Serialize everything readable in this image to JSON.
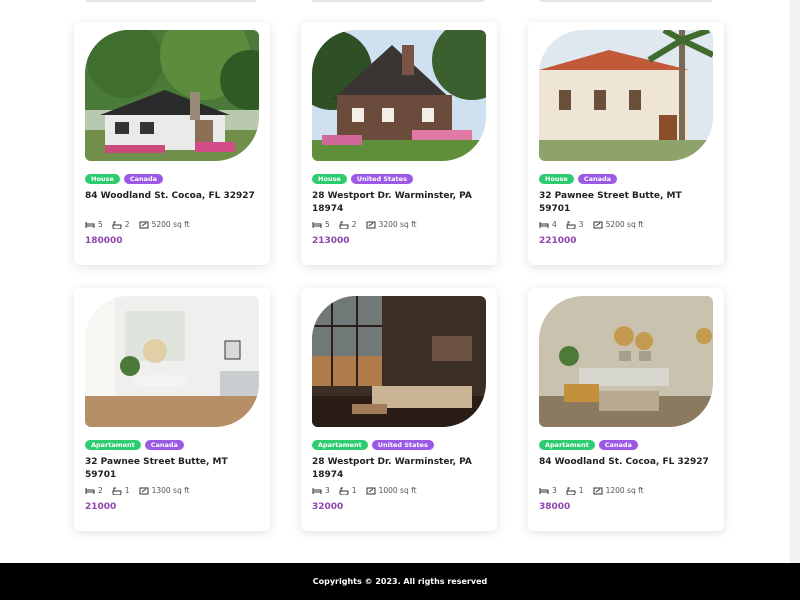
{
  "listings": [
    {
      "type": "House",
      "country": "Canada",
      "address": "84 Woodland St. Cocoa, FL 32927",
      "beds": "5",
      "baths": "2",
      "area": "5200 sq ft",
      "price": "180000"
    },
    {
      "type": "House",
      "country": "United States",
      "address": "28 Westport Dr. Warminster, PA 18974",
      "beds": "5",
      "baths": "2",
      "area": "3200 sq ft",
      "price": "213000"
    },
    {
      "type": "House",
      "country": "Canada",
      "address": "32 Pawnee Street Butte, MT 59701",
      "beds": "4",
      "baths": "3",
      "area": "5200 sq ft",
      "price": "221000"
    },
    {
      "type": "Apartament",
      "country": "Canada",
      "address": "32 Pawnee Street Butte, MT 59701",
      "beds": "2",
      "baths": "1",
      "area": "1300 sq ft",
      "price": "21000"
    },
    {
      "type": "Apartament",
      "country": "United States",
      "address": "28 Westport Dr. Warminster, PA 18974",
      "beds": "3",
      "baths": "1",
      "area": "1000 sq ft",
      "price": "32000"
    },
    {
      "type": "Apartament",
      "country": "Canada",
      "address": "84 Woodland St. Cocoa, FL 32927",
      "beds": "3",
      "baths": "1",
      "area": "1200 sq ft",
      "price": "38000"
    }
  ],
  "footer": {
    "text": "Copyrights © 2023. All rigths reserved"
  },
  "colors": {
    "type_tag": "#2ecc71",
    "country_tag": "#9b59e6",
    "price": "#8e44ad",
    "footer_bg": "#000000"
  }
}
